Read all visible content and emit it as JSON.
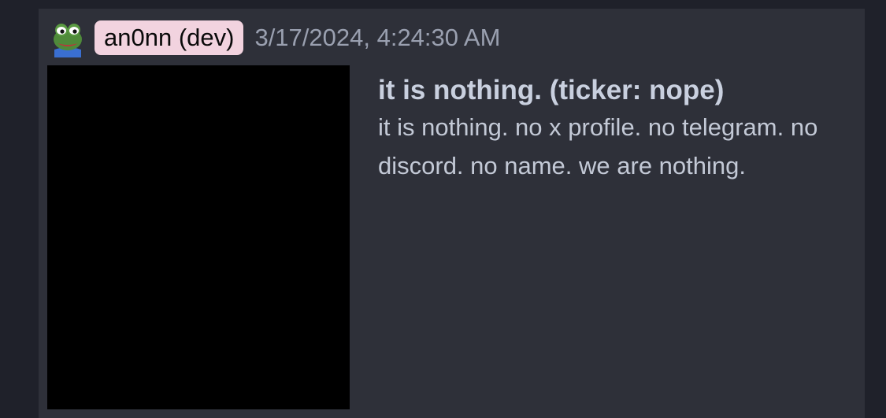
{
  "post": {
    "author": {
      "avatar_icon": "pepe-frog-icon",
      "name": "an0nn (dev)",
      "badge_color": "#f2d3df"
    },
    "timestamp": "3/17/2024, 4:24:30 AM",
    "image": {
      "fill_color": "#000000"
    },
    "title": "it is nothing. (ticker: nope)",
    "description": "it is nothing. no x profile. no telegram. no discord. no name. we are nothing."
  },
  "colors": {
    "page_background": "#1f212a",
    "card_background": "#2e3039",
    "title_text": "#c9d0df",
    "body_text": "#c3c9d6",
    "timestamp_text": "#9aa0b0"
  }
}
